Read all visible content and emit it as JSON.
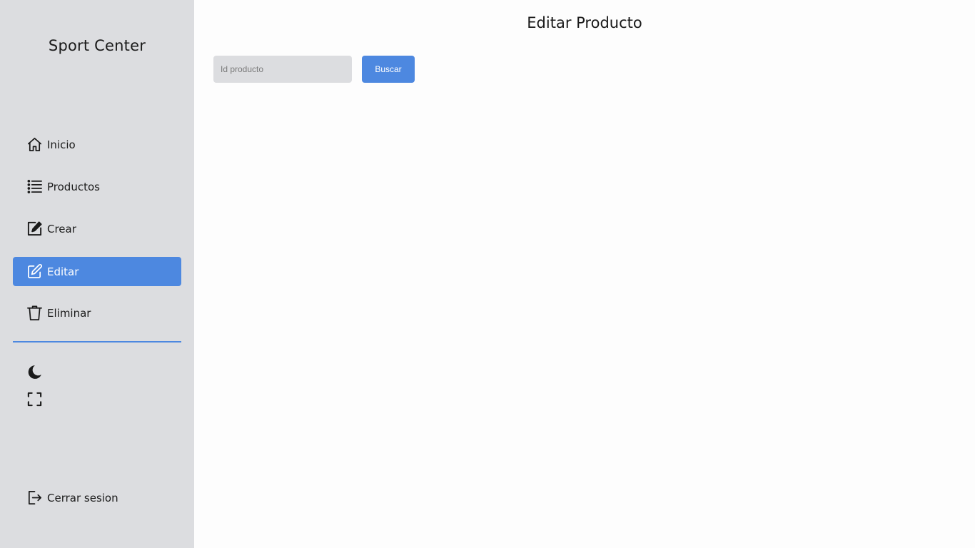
{
  "sidebar": {
    "brand": "Sport Center",
    "items": [
      {
        "label": "Inicio",
        "icon": "home-icon"
      },
      {
        "label": "Productos",
        "icon": "list-icon"
      },
      {
        "label": "Crear",
        "icon": "create-icon"
      },
      {
        "label": "Editar",
        "icon": "edit-icon",
        "active": true
      },
      {
        "label": "Eliminar",
        "icon": "trash-icon"
      }
    ],
    "tools": [
      {
        "icon": "moon-icon"
      },
      {
        "icon": "fullscreen-icon"
      }
    ],
    "logout": {
      "label": "Cerrar sesion",
      "icon": "logout-icon"
    }
  },
  "main": {
    "title": "Editar Producto",
    "search": {
      "placeholder": "Id producto",
      "value": "",
      "button_label": "Buscar"
    }
  },
  "colors": {
    "accent": "#4d88e0",
    "sidebar_bg": "#dcdde0",
    "page_bg": "#fdfdfd"
  }
}
